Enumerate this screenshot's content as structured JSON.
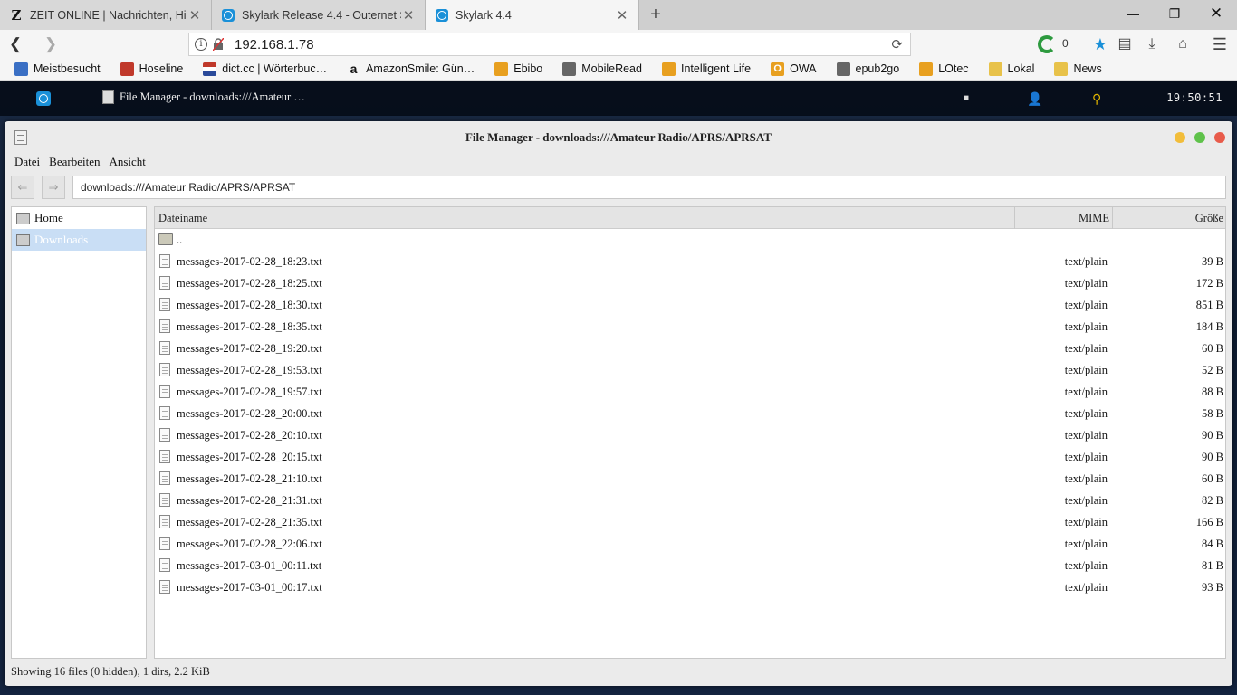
{
  "browser": {
    "tabs": [
      {
        "title": "ZEIT ONLINE | Nachrichten, Hin…",
        "icon": "zeit-z-icon"
      },
      {
        "title": "Skylark Release 4.4 - Outernet S…",
        "icon": "skylark-icon"
      },
      {
        "title": "Skylark 4.4",
        "icon": "skylark-icon",
        "active": true
      }
    ],
    "url": "192.168.1.78",
    "extension_count": "0",
    "bookmarks": [
      {
        "label": "Meistbesucht",
        "icon": "frequent-icon"
      },
      {
        "label": "Hoseline",
        "icon": "hoseline-icon"
      },
      {
        "label": "dict.cc | Wörterbuc…",
        "icon": "flag-nl-icon"
      },
      {
        "label": "AmazonSmile: Gün…",
        "icon": "amazon-icon"
      },
      {
        "label": "Ebibo",
        "icon": "rss-icon"
      },
      {
        "label": "MobileRead",
        "icon": "globe-icon"
      },
      {
        "label": "Intelligent Life",
        "icon": "rss-icon"
      },
      {
        "label": "OWA",
        "icon": "owa-icon"
      },
      {
        "label": "epub2go",
        "icon": "globe-icon"
      },
      {
        "label": "LOtec",
        "icon": "rss-icon"
      },
      {
        "label": "Lokal",
        "icon": "folder-icon"
      },
      {
        "label": "News",
        "icon": "folder-icon"
      }
    ]
  },
  "skylark": {
    "taskbar_item": "File Manager - downloads:///Amateur …",
    "clock": "19:50:51"
  },
  "filemanager": {
    "title": "File Manager - downloads:///Amateur Radio/APRS/APRSAT",
    "menu": [
      "Datei",
      "Bearbeiten",
      "Ansicht"
    ],
    "path": "downloads:///Amateur Radio/APRS/APRSAT",
    "sidebar": [
      {
        "label": "Home",
        "selected": false
      },
      {
        "label": "Downloads",
        "selected": true
      }
    ],
    "columns": {
      "name": "Dateiname",
      "mime": "MIME",
      "size": "Größe"
    },
    "parent_dir": "..",
    "files": [
      {
        "name": "messages-2017-02-28_18:23.txt",
        "mime": "text/plain",
        "size": "39 B"
      },
      {
        "name": "messages-2017-02-28_18:25.txt",
        "mime": "text/plain",
        "size": "172 B"
      },
      {
        "name": "messages-2017-02-28_18:30.txt",
        "mime": "text/plain",
        "size": "851 B"
      },
      {
        "name": "messages-2017-02-28_18:35.txt",
        "mime": "text/plain",
        "size": "184 B"
      },
      {
        "name": "messages-2017-02-28_19:20.txt",
        "mime": "text/plain",
        "size": "60 B"
      },
      {
        "name": "messages-2017-02-28_19:53.txt",
        "mime": "text/plain",
        "size": "52 B"
      },
      {
        "name": "messages-2017-02-28_19:57.txt",
        "mime": "text/plain",
        "size": "88 B"
      },
      {
        "name": "messages-2017-02-28_20:00.txt",
        "mime": "text/plain",
        "size": "58 B"
      },
      {
        "name": "messages-2017-02-28_20:10.txt",
        "mime": "text/plain",
        "size": "90 B"
      },
      {
        "name": "messages-2017-02-28_20:15.txt",
        "mime": "text/plain",
        "size": "90 B"
      },
      {
        "name": "messages-2017-02-28_21:10.txt",
        "mime": "text/plain",
        "size": "60 B"
      },
      {
        "name": "messages-2017-02-28_21:31.txt",
        "mime": "text/plain",
        "size": "82 B"
      },
      {
        "name": "messages-2017-02-28_21:35.txt",
        "mime": "text/plain",
        "size": "166 B"
      },
      {
        "name": "messages-2017-02-28_22:06.txt",
        "mime": "text/plain",
        "size": "84 B"
      },
      {
        "name": "messages-2017-03-01_00:11.txt",
        "mime": "text/plain",
        "size": "81 B"
      },
      {
        "name": "messages-2017-03-01_00:17.txt",
        "mime": "text/plain",
        "size": "93 B"
      }
    ],
    "status": "Showing 16 files (0 hidden), 1 dirs, 2.2 KiB"
  },
  "colors": {
    "accent": "#1a90d8",
    "selection": "#c9def5",
    "close_dot": "#e85b4a",
    "min_dot": "#f2bd3a",
    "max_dot": "#5fc24a"
  }
}
